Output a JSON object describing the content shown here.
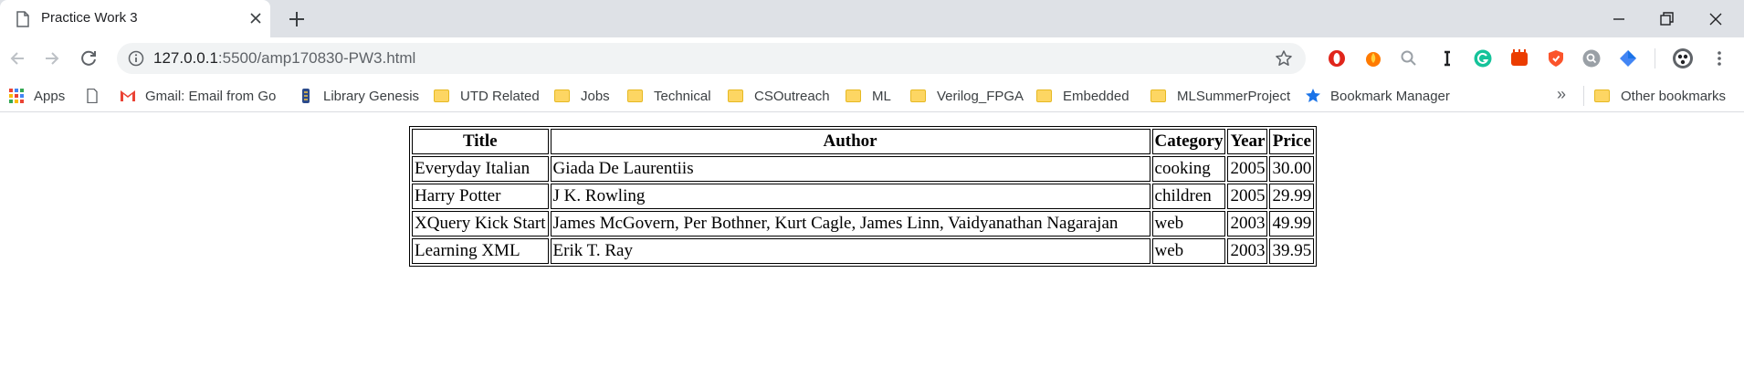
{
  "browser": {
    "tab": {
      "title": "Practice Work 3"
    },
    "url": {
      "host": "127.0.0.1",
      "rest": ":5500/amp170830-PW3.html"
    }
  },
  "bookmarks": {
    "items": [
      {
        "label": "Apps",
        "icon": "apps-grid-icon"
      },
      {
        "label": "",
        "icon": "page-icon"
      },
      {
        "label": "Gmail: Email from Go",
        "icon": "gmail-icon"
      },
      {
        "label": "Library Genesis",
        "icon": "library-genesis-icon"
      },
      {
        "label": "UTD Related",
        "icon": "folder-icon"
      },
      {
        "label": "Jobs",
        "icon": "folder-icon"
      },
      {
        "label": "Technical",
        "icon": "folder-icon"
      },
      {
        "label": "CSOutreach",
        "icon": "folder-icon"
      },
      {
        "label": "ML",
        "icon": "folder-icon"
      },
      {
        "label": "Verilog_FPGA",
        "icon": "folder-icon"
      },
      {
        "label": "Embedded",
        "icon": "folder-icon"
      },
      {
        "label": "MLSummerProject",
        "icon": "folder-icon"
      },
      {
        "label": "Bookmark Manager",
        "icon": "star-icon"
      }
    ],
    "overflow": "»",
    "other": "Other bookmarks"
  },
  "table": {
    "headers": [
      "Title",
      "Author",
      "Category",
      "Year",
      "Price"
    ],
    "rows": [
      [
        "Everyday Italian",
        "Giada De Laurentiis",
        "cooking",
        "2005",
        "30.00"
      ],
      [
        "Harry Potter",
        "J K. Rowling",
        "children",
        "2005",
        "29.99"
      ],
      [
        "XQuery Kick Start",
        "James McGovern, Per Bothner, Kurt Cagle, James Linn, Vaidyanathan Nagarajan",
        "web",
        "2003",
        "49.99"
      ],
      [
        "Learning XML",
        "Erik T. Ray",
        "web",
        "2003",
        "39.95"
      ]
    ]
  }
}
